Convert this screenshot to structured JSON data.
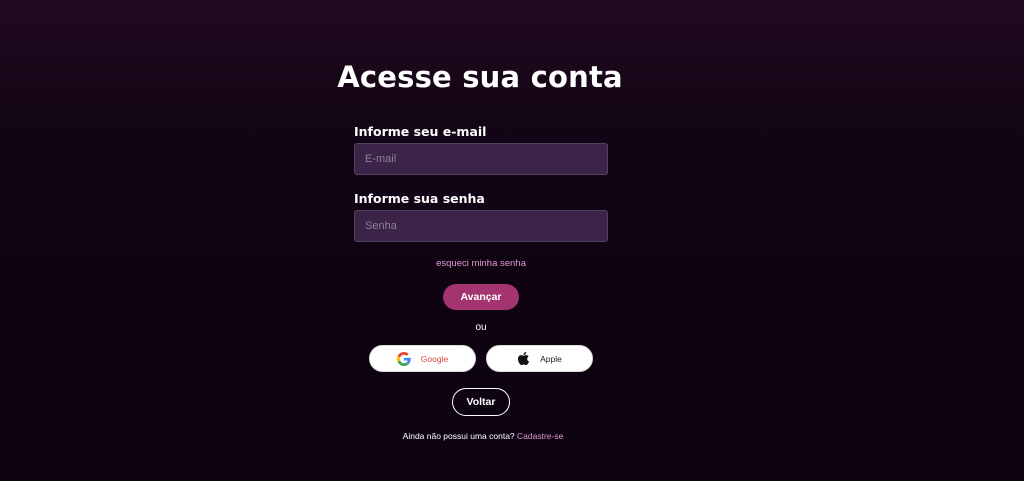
{
  "page": {
    "title": "Acesse sua conta"
  },
  "form": {
    "email_label": "Informe seu e-mail",
    "email_placeholder": "E-mail",
    "email_value": "",
    "password_label": "Informe sua senha",
    "password_placeholder": "Senha",
    "password_value": "",
    "forgot_link": "esqueci minha senha",
    "submit_label": "Avançar",
    "or_text": "ou"
  },
  "social": {
    "google_label": "Google",
    "google_icon": "google-icon",
    "apple_label": "Apple",
    "apple_icon": "apple-icon"
  },
  "footer": {
    "back_label": "Voltar",
    "signup_prompt": "Ainda não possui uma conta?",
    "signup_link": "Cadastre-se"
  },
  "colors": {
    "background": "#140516",
    "input_bg": "#3b2447",
    "accent": "#a3346f",
    "link": "#e29ad0",
    "google_text": "#d9453b"
  }
}
